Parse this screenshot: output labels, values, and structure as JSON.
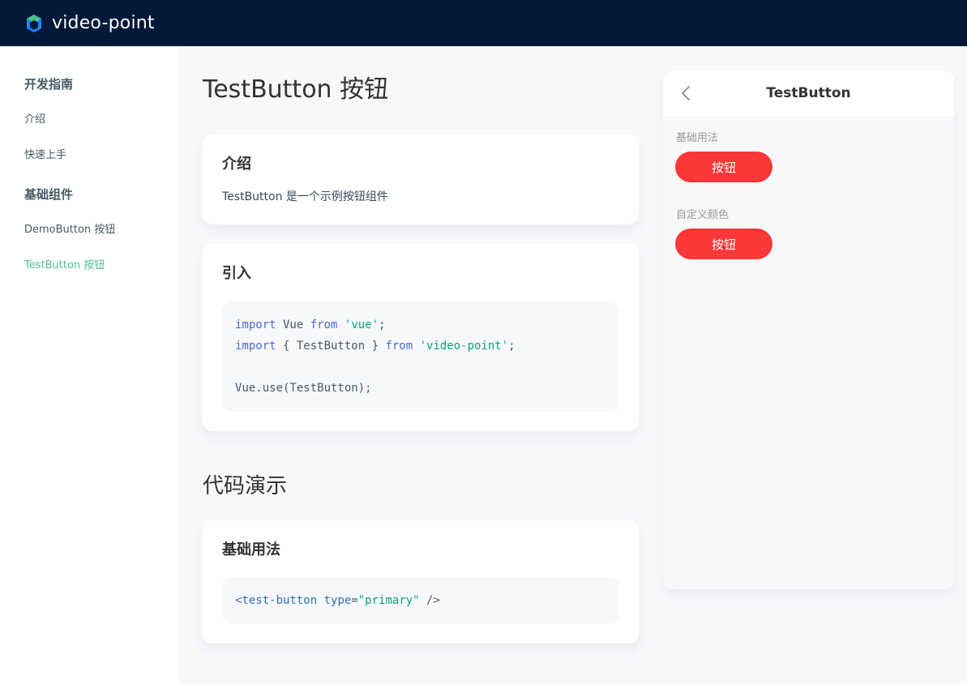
{
  "header": {
    "brand": "video-point"
  },
  "sidebar": {
    "groups": [
      {
        "title": "开发指南",
        "items": [
          "介绍",
          "快速上手"
        ]
      },
      {
        "title": "基础组件",
        "items": [
          "DemoButton 按钮",
          "TestButton 按钮"
        ]
      }
    ],
    "active": "TestButton 按钮"
  },
  "main": {
    "page_title": "TestButton 按钮",
    "intro": {
      "title": "介绍",
      "text": "TestButton 是一个示例按钮组件"
    },
    "import": {
      "title": "引入",
      "code": {
        "line1": {
          "kw1": "import",
          "mid": " Vue ",
          "kw2": "from",
          "sp": " ",
          "str": "'vue'",
          "end": ";"
        },
        "line2": {
          "kw1": "import",
          "mid": " { TestButton } ",
          "kw2": "from",
          "sp": " ",
          "str": "'video-point'",
          "end": ";"
        },
        "line4": "Vue.use(TestButton);"
      }
    },
    "demo_section_title": "代码演示",
    "basic_usage": {
      "title": "基础用法",
      "code": {
        "open": "<",
        "tag": "test-button",
        "sp": " ",
        "attr": "type",
        "eq": "=",
        "val": "\"primary\"",
        "close": " />"
      }
    }
  },
  "simulator": {
    "title": "TestButton",
    "demos": [
      {
        "title": "基础用法",
        "button": "按钮"
      },
      {
        "title": "自定义颜色",
        "button": "按钮"
      }
    ]
  },
  "colors": {
    "header_bg": "#001938",
    "active_link": "#4fc08d",
    "button_red": "#fb3838",
    "keyword": "#4f67d8",
    "string": "#07a474"
  },
  "icons": {
    "logo": "video-point-logo-icon",
    "back": "chevron-left-icon"
  }
}
